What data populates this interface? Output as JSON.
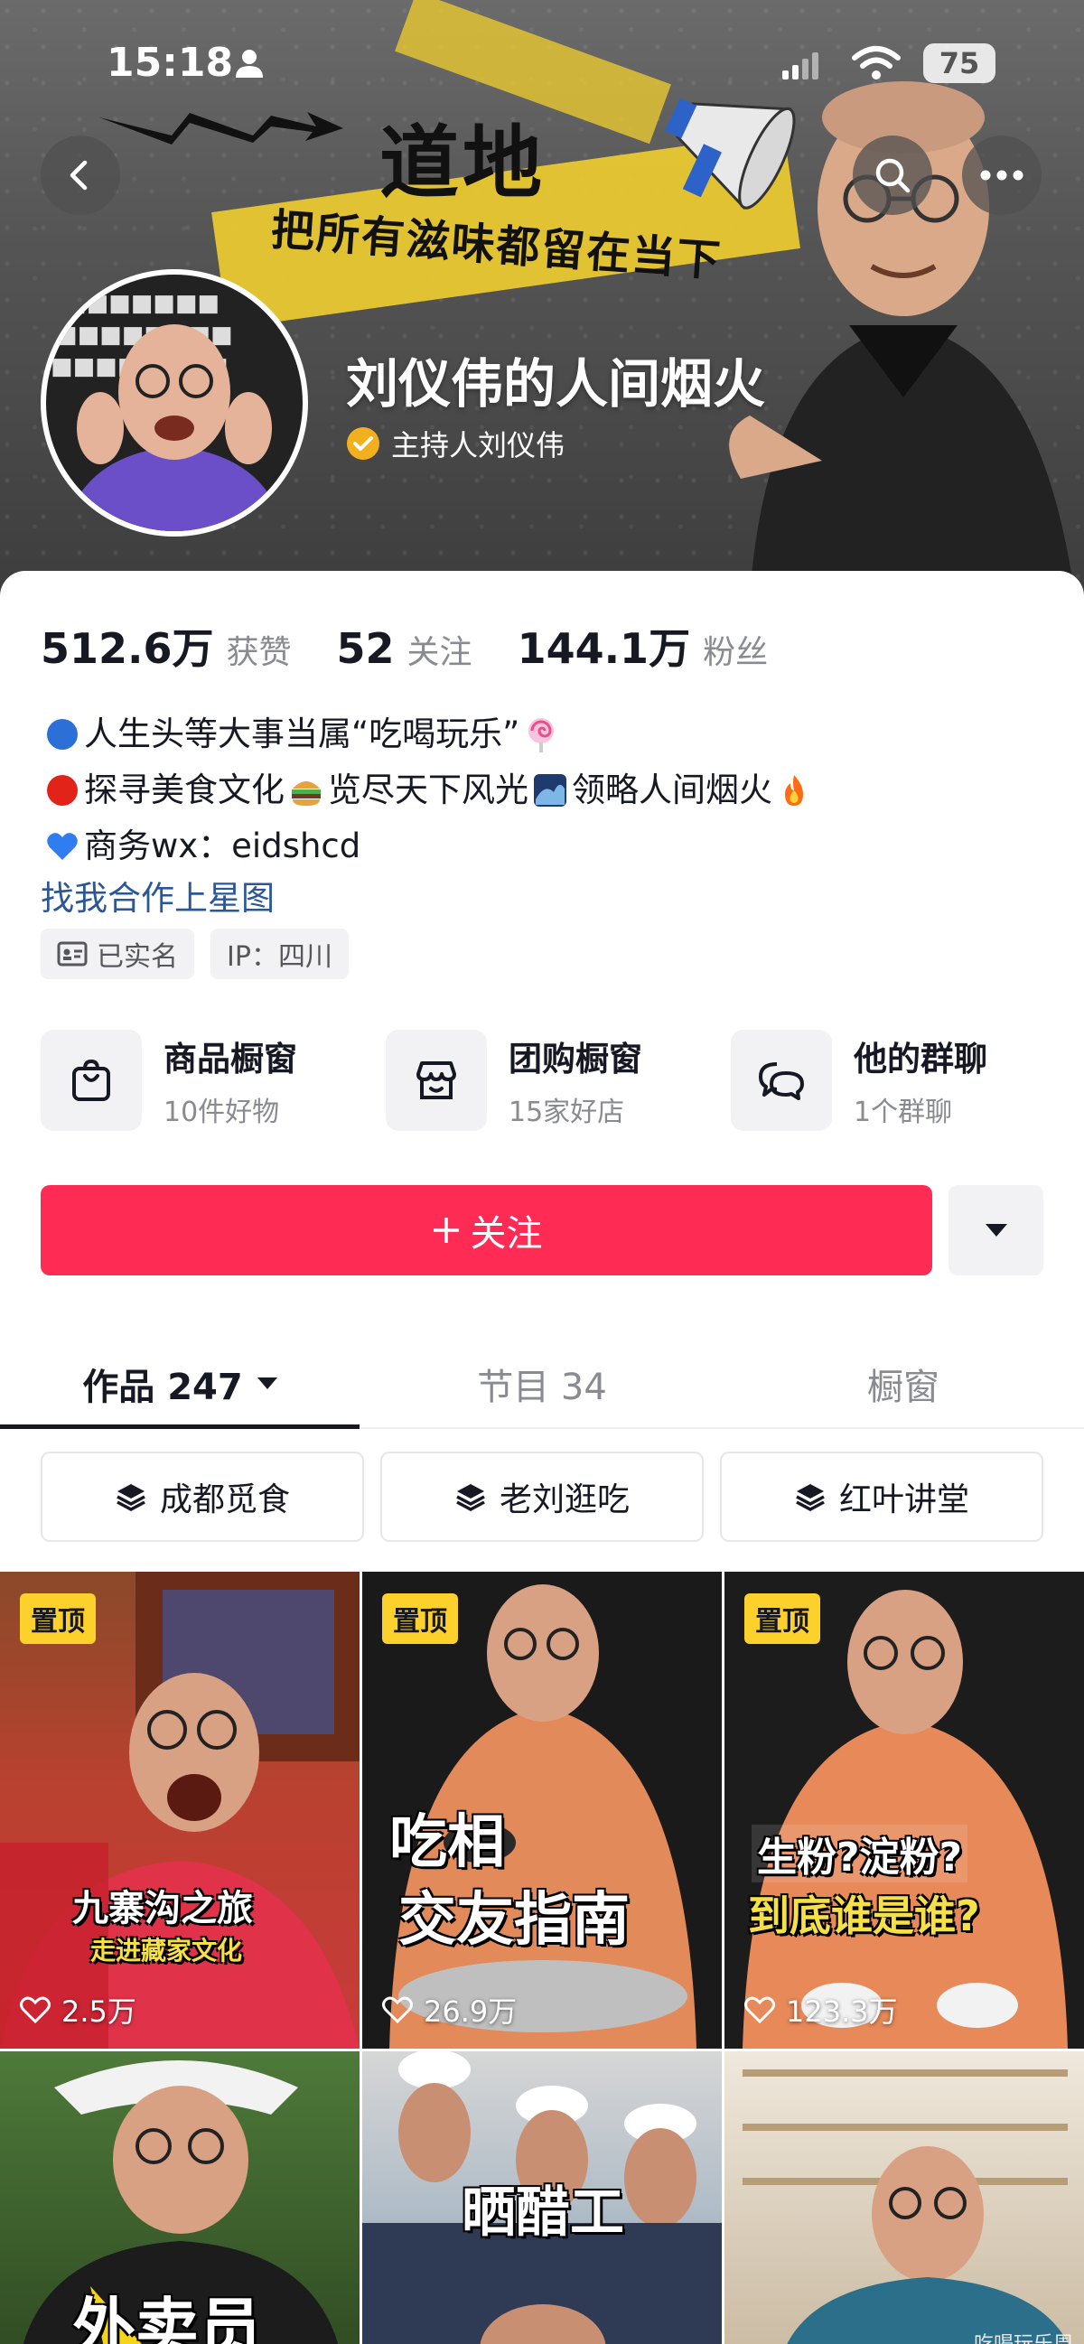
{
  "status_bar": {
    "time": "15:18",
    "battery": "75"
  },
  "banner": {
    "title": "道地",
    "slogan": "把所有滋味都留在当下"
  },
  "profile": {
    "nickname": "刘仪伟的人间烟火",
    "verified_label": "主持人刘仪伟",
    "verified_color": "#f2b01e"
  },
  "stats": [
    {
      "num": "512.6万",
      "label": "获赞"
    },
    {
      "num": "52",
      "label": "关注"
    },
    {
      "num": "144.1万",
      "label": "粉丝"
    }
  ],
  "bio": {
    "line1": "人生头等大事当属“吃喝玩乐”",
    "line2a": "探寻美食文化",
    "line2b": "览尽天下风光",
    "line2c": "领略人间烟火",
    "line3": "商务wx：eidshcd",
    "link": "找我合作上星图"
  },
  "tags": [
    {
      "icon": "id-card-icon",
      "label": "已实名"
    },
    {
      "icon": "",
      "label": "IP：四川"
    }
  ],
  "entries": [
    {
      "icon": "shopping-bag-icon",
      "title": "商品橱窗",
      "sub": "10件好物"
    },
    {
      "icon": "store-icon",
      "title": "团购橱窗",
      "sub": "15家好店"
    },
    {
      "icon": "chat-icon",
      "title": "他的群聊",
      "sub": "1个群聊"
    }
  ],
  "follow": {
    "label": "关注",
    "color": "#fe2c55"
  },
  "tabs": [
    {
      "label": "作品 247",
      "active": true
    },
    {
      "label": "节目 34",
      "active": false
    },
    {
      "label": "橱窗",
      "active": false
    }
  ],
  "collections": [
    {
      "icon": "stack-icon",
      "label": "成都觅食"
    },
    {
      "icon": "stack-icon",
      "label": "老刘逛吃"
    },
    {
      "icon": "stack-icon",
      "label": "红叶讲堂"
    }
  ],
  "videos": [
    {
      "pinned": "置顶",
      "likes": "2.5万",
      "cap1": "九寨沟之旅",
      "cap2": "走进藏家文化"
    },
    {
      "pinned": "置顶",
      "likes": "26.9万",
      "cap1": "吃相",
      "cap2": "交友指南"
    },
    {
      "pinned": "置顶",
      "likes": "123.3万",
      "cap1": "生粉?淀粉?",
      "cap2": "到底谁是谁?"
    },
    {
      "cap1": "外卖员"
    },
    {
      "cap1": "晒醋工"
    },
    {
      "watermark": "吃喝玩乐周"
    }
  ]
}
